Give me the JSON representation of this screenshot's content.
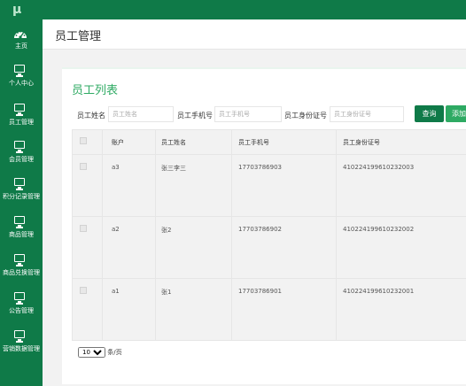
{
  "app": {
    "logo_text": "µ"
  },
  "sidebar": {
    "items": [
      {
        "label": "主页",
        "icon": "dashboard-icon"
      },
      {
        "label": "个人中心",
        "icon": "monitor-icon"
      },
      {
        "label": "员工管理",
        "icon": "monitor-icon"
      },
      {
        "label": "会员管理",
        "icon": "monitor-icon"
      },
      {
        "label": "积分记录管理",
        "icon": "monitor-icon"
      },
      {
        "label": "商品管理",
        "icon": "monitor-icon"
      },
      {
        "label": "商品兑换管理",
        "icon": "monitor-icon"
      },
      {
        "label": "公告管理",
        "icon": "monitor-icon"
      },
      {
        "label": "营销数据管理",
        "icon": "monitor-icon"
      }
    ]
  },
  "header": {
    "title": "员工管理"
  },
  "card": {
    "title": "员工列表"
  },
  "filters": {
    "name_label": "员工姓名",
    "name_placeholder": "员工姓名",
    "phone_label": "员工手机号",
    "phone_placeholder": "员工手机号",
    "id_label": "员工身份证号",
    "id_placeholder": "员工身份证号"
  },
  "buttons": {
    "query": "查询",
    "add": "添加"
  },
  "table": {
    "headers": [
      "账户",
      "员工姓名",
      "员工手机号",
      "员工身份证号"
    ],
    "rows": [
      {
        "account": "a3",
        "name": "张三李三",
        "phone": "17703786903",
        "id_number": "410224199610232003"
      },
      {
        "account": "a2",
        "name": "张2",
        "phone": "17703786902",
        "id_number": "410224199610232002"
      },
      {
        "account": "a1",
        "name": "张1",
        "phone": "17703786901",
        "id_number": "410224199610232001"
      }
    ]
  },
  "pager": {
    "page_size": "10",
    "suffix": "条/页"
  },
  "colors": {
    "brand": "#0f7a48",
    "accent": "#2eaa63"
  }
}
